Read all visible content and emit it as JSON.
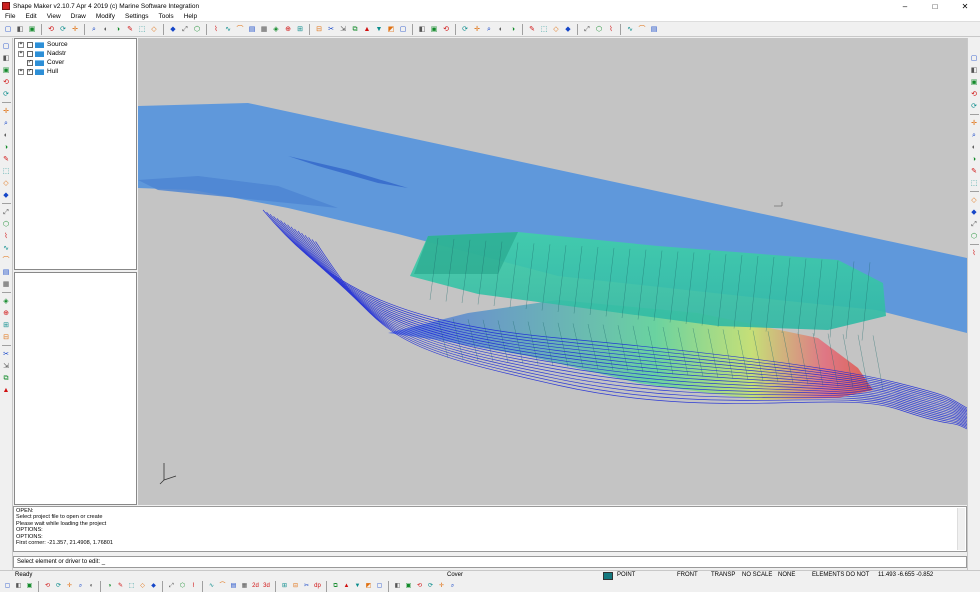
{
  "window": {
    "title": "Shape Maker v2.10.7 Apr  4 2019 (c) Marine Software Integration",
    "minimize": "–",
    "maximize": "□",
    "close": "✕"
  },
  "menu": [
    "File",
    "Edit",
    "View",
    "Draw",
    "Modify",
    "Settings",
    "Tools",
    "Help"
  ],
  "toolbar_icons": [
    "new-file-icon",
    "open-folder-icon",
    "save-icon",
    "sep",
    "undo-icon",
    "redo-icon",
    "help-pointer-icon",
    "sep",
    "zoom-window-icon",
    "zoom-all-icon",
    "zoom-extents-icon",
    "zoom-previous-icon",
    "zoom-in-icon",
    "zoom-out-icon",
    "sep",
    "pan-icon",
    "rotate-view-icon",
    "redraw-icon",
    "sep",
    "select-icon",
    "layer-icon",
    "point-icon",
    "line-icon",
    "node-icon",
    "grid-icon",
    "snap-icon",
    "frame-icon",
    "sep",
    "polyline-icon",
    "curve-icon",
    "spline-icon",
    "arc-icon",
    "surface-icon",
    "patch-icon",
    "mesh-icon",
    "fill-icon",
    "sep",
    "hull-icon",
    "deck-icon",
    "section-icon",
    "sep",
    "trim-icon",
    "extend-icon",
    "offset-icon",
    "mirror-icon",
    "copy-icon",
    "sep",
    "measure-icon",
    "hydrostatics-icon",
    "curvature-icon",
    "delete-icon",
    "sep",
    "shade-icon",
    "wireframe-icon",
    "transparent-icon",
    "sep",
    "render-icon",
    "light-icon",
    "view-settings-icon"
  ],
  "left_tool_icons": [
    "draw-line-icon",
    "draw-rect-icon",
    "draw-arc-icon",
    "draw-wave-icon",
    "draw-spline-icon",
    "sep",
    "edit-node-icon",
    "move-node-icon",
    "trim-curve-icon",
    "join-icon",
    "break-icon",
    "extend-icon",
    "fillet-icon",
    "chamfer-icon",
    "sep",
    "surface-from-curves-icon",
    "loft-icon",
    "sweep-icon",
    "patch-icon",
    "blend-icon",
    "fill-surface-icon",
    "color-surface-icon",
    "sep",
    "intersect-icon",
    "split-icon",
    "project-icon",
    "offset-surface-icon",
    "sep",
    "analysis-icon",
    "curvature-map-icon",
    "section-cut-icon",
    "check-icon"
  ],
  "right_tool_icons": [
    "pencil-icon",
    "green-surface-icon",
    "teal-surface-icon",
    "cyan-surface-icon",
    "layer-surface-icon",
    "sep",
    "view-front-icon",
    "view-side-icon",
    "view-top-icon",
    "view-iso-icon",
    "hull-view-icon",
    "deck-view-icon",
    "sep",
    "grid-on-icon",
    "grid-snap-icon",
    "table-icon",
    "spreadsheet-icon",
    "sep",
    "properties-icon"
  ],
  "tree": [
    {
      "label": "Source",
      "expander": "+",
      "checked": false
    },
    {
      "label": "Nadstr",
      "expander": "+",
      "checked": false
    },
    {
      "label": "Cover",
      "expander": "",
      "checked": true
    },
    {
      "label": "Hull",
      "expander": "+",
      "checked": true
    }
  ],
  "console": {
    "lines": [
      "OPEN:",
      "Select project file to open or create",
      "Please wait while loading the project",
      "OPTIONS:",
      "OPTIONS:",
      "First corner: -21.357, 21.4908, 1.76801"
    ]
  },
  "command_prompt": "Select element or driver to edit: _",
  "status": {
    "ready": "Ready",
    "layer": "Cover",
    "layer_color": "#14787e",
    "entity": "POINT",
    "view": "FRONT",
    "transp": "TRANSP",
    "scale": "NO SCALE",
    "none": "NONE",
    "elements": "ELEMENTS",
    "do_not": "DO NOT",
    "coords": "11.493 -6.655 -0.852"
  },
  "bottom_tool_icons": [
    "b-select-icon",
    "b-point-icon",
    "b-line-icon",
    "sep",
    "b-arc-icon",
    "b-arc2-icon",
    "b-circle-icon",
    "b-rect-icon",
    "b-poly-icon",
    "sep",
    "b-surface-icon",
    "b-curve-icon",
    "b-trim-icon",
    "b-mirror-icon",
    "b-move-icon",
    "sep",
    "b-node-icon",
    "b-node2-icon",
    "b-split-icon",
    "sep",
    "b-snap-end-icon",
    "b-snap-mid-icon",
    "b-snap-int-icon",
    "b-snap-perp-icon",
    "b-2d-icon",
    "b-3d-icon",
    "sep",
    "b-red-curve-icon",
    "b-up-icon",
    "b-pin-icon",
    "b-dp-icon",
    "sep",
    "b-line-tool-icon",
    "b-polyline-icon",
    "b-arc-tool-icon",
    "b-curve-tool-icon",
    "b-offset-icon",
    "sep",
    "b-layer-icon",
    "b-render-icon",
    "b-shade-icon",
    "b-wire-icon",
    "b-grid-icon",
    "b-lock-icon"
  ],
  "bottom_labels": {
    "twod": "2d",
    "threed": "3d",
    "dp": "dp"
  }
}
